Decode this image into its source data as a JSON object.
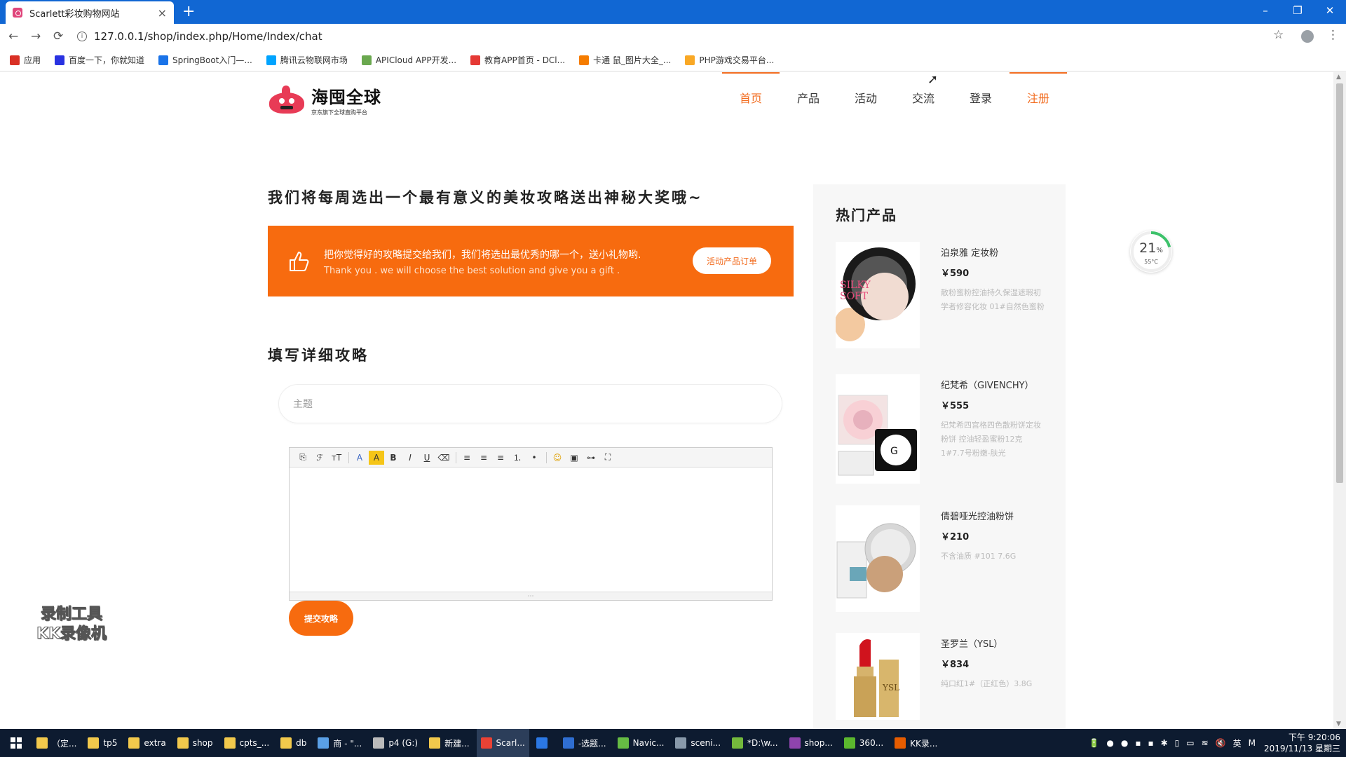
{
  "browser": {
    "tab_title": "Scarlett彩妆购物网站",
    "tab_close": "×",
    "new_tab": "+",
    "url": "127.0.0.1/shop/index.php/Home/Index/chat",
    "back": "←",
    "forward": "→",
    "reload": "⟳",
    "star": "☆",
    "menu": "⋮",
    "win_min": "–",
    "win_restore": "❐",
    "win_close": "✕",
    "bookmarks": [
      {
        "label": "应用",
        "color": "#d93025"
      },
      {
        "label": "百度一下，你就知道",
        "color": "#2932e1"
      },
      {
        "label": "SpringBoot入门—...",
        "color": "#1a73e8"
      },
      {
        "label": "腾讯云物联网市场",
        "color": "#00a4ff"
      },
      {
        "label": "APICloud APP开发...",
        "color": "#6aa84f"
      },
      {
        "label": "教育APP首页 - DCl...",
        "color": "#e53935"
      },
      {
        "label": "卡通 鼠_图片大全_...",
        "color": "#f57c00"
      },
      {
        "label": "PHP游戏交易平台...",
        "color": "#f9a825"
      }
    ]
  },
  "site": {
    "logo_name": "海囤全球",
    "logo_tagline": "京东旗下全球直购平台",
    "nav": [
      "首页",
      "产品",
      "活动",
      "交流",
      "登录",
      "注册"
    ],
    "headline": "我们将每周选出一个最有意义的美妆攻略送出神秘大奖哦~",
    "banner": {
      "cn": "把你觉得好的攻略提交给我们，我们将选出最优秀的哪一个，送小礼物哟.",
      "en": "Thank you . we will choose the best solution and give you a gift .",
      "button": "活动产品订单"
    },
    "form_heading": "填写详细攻略",
    "subject_placeholder": "主题",
    "submit": "提交攻略",
    "editor_tools": [
      "⎘",
      "ℱ",
      "тT",
      "A",
      "A",
      "B",
      "I",
      "U",
      "⌫",
      "≡",
      "≡",
      "≡",
      "⒈",
      "•",
      "☺",
      "▣",
      "⊶",
      "⛶"
    ]
  },
  "sidebar": {
    "title": "热门产品",
    "products": [
      {
        "name": "泊泉雅 定妆粉",
        "price": "￥590",
        "desc": "散粉蜜粉控油持久保湿遮瑕初学者修容化妆 01#自然色蜜粉"
      },
      {
        "name": "纪梵希（GIVENCHY）",
        "price": "￥555",
        "desc": "纪梵希四宫格四色散粉饼定妆粉饼 控油轻盈蜜粉12克 1#7.7号粉嫩-肤光"
      },
      {
        "name": "倩碧哑光控油粉饼",
        "price": "￥210",
        "desc": "不含油质 #101 7.6G"
      },
      {
        "name": "圣罗兰（YSL）",
        "price": "￥834",
        "desc": "纯口红1#（正红色）3.8G"
      }
    ]
  },
  "widget": {
    "percent": "21",
    "percent_unit": "%",
    "temp": "55°C",
    "usage": 0.21
  },
  "watermark": [
    "录制工具",
    "KK录像机"
  ],
  "taskbar": {
    "items": [
      {
        "label": "（定...",
        "color": "#f2c94c"
      },
      {
        "label": "tp5",
        "color": "#f2c94c"
      },
      {
        "label": "extra",
        "color": "#f2c94c"
      },
      {
        "label": "shop",
        "color": "#f2c94c"
      },
      {
        "label": "cpts_...",
        "color": "#f2c94c"
      },
      {
        "label": "db",
        "color": "#f2c94c"
      },
      {
        "label": "商 - \"...",
        "color": "#5aa0e6"
      },
      {
        "label": "p4 (G:)",
        "color": "#bbbbbb"
      },
      {
        "label": "新建...",
        "color": "#f2c94c"
      },
      {
        "label": "Scarl...",
        "color": "#e94235"
      },
      {
        "label": "",
        "color": "#2b78e4"
      },
      {
        "label": "-选题...",
        "color": "#2f6ed1"
      },
      {
        "label": "Navic...",
        "color": "#66bb44"
      },
      {
        "label": "sceni...",
        "color": "#8899aa"
      },
      {
        "label": "*D:\\w...",
        "color": "#74b93c"
      },
      {
        "label": "shop...",
        "color": "#8e44ad"
      },
      {
        "label": "360...",
        "color": "#5cb82e"
      },
      {
        "label": "KK录...",
        "color": "#e65c00"
      }
    ],
    "tray": [
      "🔋",
      "●",
      "●",
      "▪",
      "▪",
      "✱",
      "▯",
      "▭",
      "≋",
      "🔇",
      "英",
      "M"
    ],
    "time": "下午 9:20:06",
    "date": "2019/11/13 星期三"
  }
}
